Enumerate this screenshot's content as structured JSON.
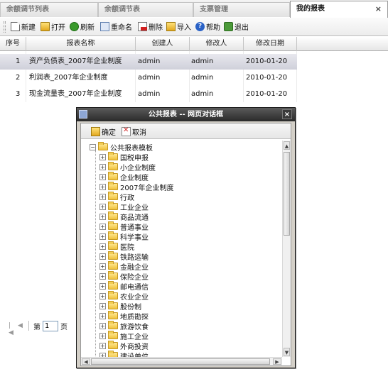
{
  "tabs": [
    {
      "label": "余额调节列表"
    },
    {
      "label": "余额调节表"
    },
    {
      "label": "支票管理"
    },
    {
      "label": "我的报表"
    }
  ],
  "tab_close_glyph": "×",
  "toolbar": {
    "new_label": "新建",
    "open_label": "打开",
    "refresh_label": "刷新",
    "rename_label": "重命名",
    "delete_label": "删除",
    "import_label": "导入",
    "help_label": "帮助",
    "exit_label": "退出"
  },
  "grid": {
    "columns": [
      "序号",
      "报表名称",
      "创建人",
      "修改人",
      "修改日期"
    ],
    "rows": [
      {
        "index": "1",
        "name": "资产负债表_2007年企业制度",
        "creator": "admin",
        "modifier": "admin",
        "date": "2010-01-20"
      },
      {
        "index": "2",
        "name": "利润表_2007年企业制度",
        "creator": "admin",
        "modifier": "admin",
        "date": "2010-01-20"
      },
      {
        "index": "3",
        "name": "现金流量表_2007年企业制度",
        "creator": "admin",
        "modifier": "admin",
        "date": "2010-01-20"
      }
    ]
  },
  "pager": {
    "prefix": "第",
    "page": "1",
    "suffix": "页"
  },
  "dialog": {
    "title": "公共报表 -- 网页对话框",
    "close_glyph": "×",
    "ok_label": "确定",
    "cancel_label": "取消",
    "tree_root": "公共报表模板",
    "tree_items": [
      "国税申报",
      "小企业制度",
      "企业制度",
      "2007年企业制度",
      "行政",
      "工业企业",
      "商品流通",
      "普通事业",
      "科学事业",
      "医院",
      "铁路运输",
      "金融企业",
      "保险企业",
      "邮电通信",
      "农业企业",
      "股份制",
      "地质勘探",
      "旅游饮食",
      "施工企业",
      "外商投资",
      "建设单位"
    ]
  },
  "colors": {
    "selected_row": "#d6d7e0",
    "dialog_title_bar": "#3a3a3a",
    "folder": "#f0c23c"
  }
}
